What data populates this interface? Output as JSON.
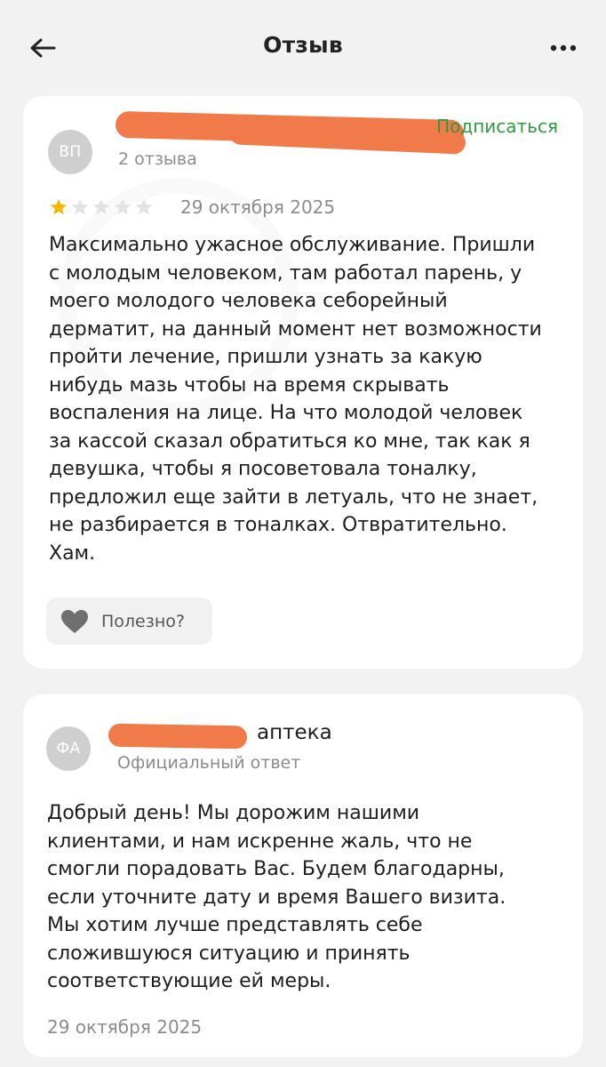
{
  "header": {
    "title": "Отзыв",
    "back_icon": "arrow-left-icon",
    "more_icon": "more-dots-icon"
  },
  "review": {
    "avatar_initials": "ВП",
    "subscribe_label": "Подписаться",
    "reviews_count": "2 отзыва",
    "rating": 1,
    "rating_max": 5,
    "date": "29 октября 2025",
    "text": "Максимально ужасное обслуживание. Пришли\nс молодым человеком, там работал парень, у\nмоего молодого человека себорейный\nдерматит, на данный момент нет возможности\nпройти лечение, пришли узнать за какую\nнибудь мазь чтобы на время скрывать\nвоспаления на лице. На что молодой человек\nза кассой сказал обратиться ко мне, так как я\nдевушка, чтобы я посоветовала тоналку,\nпредложил еще зайти в летуаль, что не знает,\nне разбирается в тоналках. Отвратительно.\nХам.",
    "helpful_label": "Полезно?"
  },
  "reply": {
    "avatar_initials": "ФА",
    "org_name_suffix": "аптека",
    "official_label": "Официальный ответ",
    "text": "Добрый день! Мы дорожим нашими\nклиентами, и нам искренне жаль, что не\nсмогли порадовать Вас. Будем благодарны,\nесли уточните дату и время Вашего визита.\nМы хотим лучше представлять себе\nсложившуюся ситуацию и принять\nсоответствующие ей меры.",
    "date": "29 октября 2025"
  },
  "colors": {
    "accent_green": "#2e9b3e",
    "star_filled": "#f5b800",
    "star_empty": "#e3e3e3",
    "redaction": "#f07a49"
  }
}
